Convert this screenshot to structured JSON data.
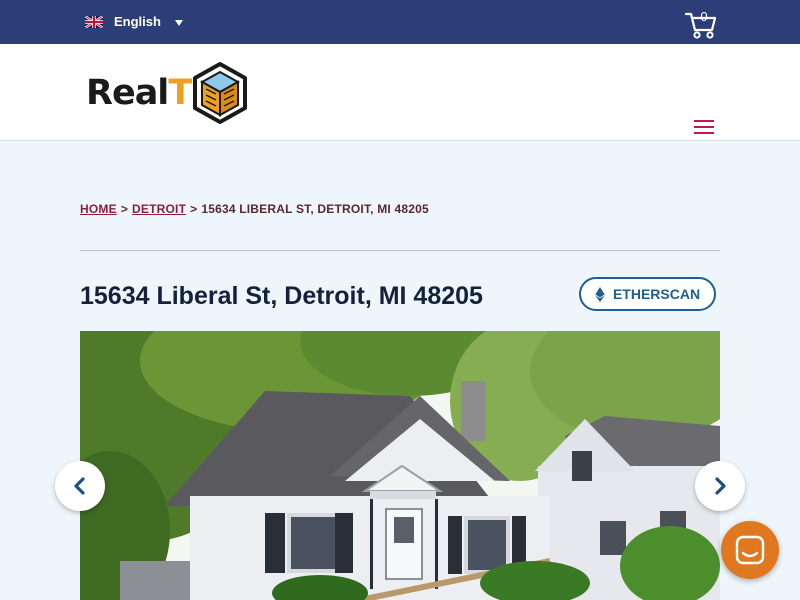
{
  "topbar": {
    "language": {
      "label": "English",
      "flag": "uk-flag-icon"
    },
    "cart": {
      "count": "0",
      "icon": "cart-icon"
    },
    "color": "#2c3e77"
  },
  "header": {
    "logo": {
      "text_main": "Real",
      "text_accent": "T"
    },
    "menu_icon": "hamburger-icon"
  },
  "breadcrumb": {
    "items": [
      {
        "label": "HOME",
        "link": true
      },
      {
        "label": "DETROIT",
        "link": true
      },
      {
        "label": "15634 LIBERAL ST, DETROIT, MI 48205",
        "link": false
      }
    ],
    "separator": ">"
  },
  "property": {
    "title": "15634 Liberal St, Detroit, MI 48205",
    "etherscan_label": "ETHERSCAN",
    "etherscan_icon": "ethereum-icon"
  },
  "gallery": {
    "prev_icon": "chevron-left-icon",
    "next_icon": "chevron-right-icon"
  },
  "chat": {
    "icon": "chat-icon",
    "color": "#e07820"
  },
  "colors": {
    "accent": "#8e1f3a",
    "etherscan": "#1e5f8f",
    "page_bg": "#eef6fc"
  }
}
